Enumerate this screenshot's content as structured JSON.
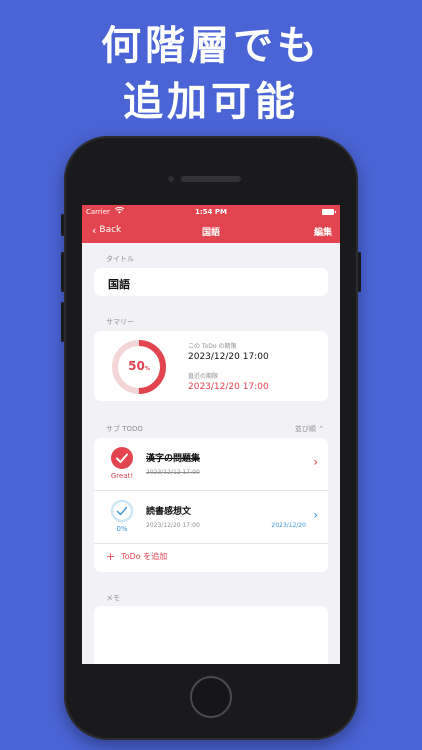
{
  "headline": {
    "line1": "何階層でも",
    "line2": "追加可能"
  },
  "status_bar": {
    "carrier": "Carrier",
    "time": "1:54 PM"
  },
  "nav": {
    "back_label": "Back",
    "title": "国語",
    "edit_label": "編集"
  },
  "title_section": {
    "label": "タイトル",
    "value": "国語"
  },
  "summary": {
    "label": "サマリー",
    "progress_percent": 50,
    "percent_text": "50",
    "percent_unit": "%",
    "this_deadline_label": "この ToDo の期限",
    "this_deadline_value": "2023/12/20 17:00",
    "nearest_deadline_label": "直近の期限",
    "nearest_deadline_value": "2023/12/20 17:00"
  },
  "sub_todo": {
    "label": "サブ TODO",
    "sort_label": "並び順 ⌃",
    "items": [
      {
        "name": "漢字の問題集",
        "date": "2023/12/12 17:00",
        "status": "Great!",
        "done": true
      },
      {
        "name": "読書感想文",
        "date": "2023/12/20 17:00",
        "due": "2023/12/20",
        "status": "0%",
        "done": false
      }
    ],
    "add_label": "ToDo を追加"
  },
  "memo": {
    "label": "メモ"
  },
  "colors": {
    "background": "#4a64d6",
    "accent_red": "#e2454f",
    "accent_blue": "#3c95d8"
  }
}
